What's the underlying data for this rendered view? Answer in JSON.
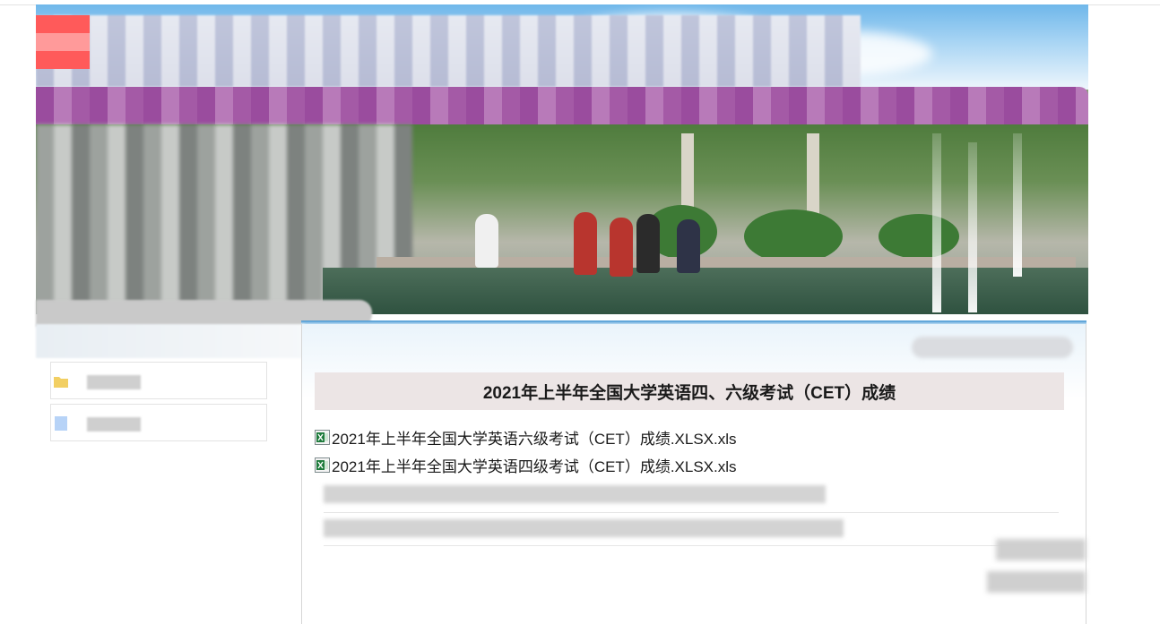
{
  "page": {
    "article_title": "2021年上半年全国大学英语四、六级考试（CET）成绩"
  },
  "attachments": [
    {
      "label": "2021年上半年全国大学英语六级考试（CET）成绩.XLSX.xls",
      "icon": "excel-file-icon"
    },
    {
      "label": "2021年上半年全国大学英语四级考试（CET）成绩.XLSX.xls",
      "icon": "excel-file-icon"
    }
  ],
  "sidebar": {
    "items": [
      {
        "icon": "folder-icon",
        "icon_color": "#f2cf63"
      },
      {
        "icon": "page-icon",
        "icon_color": "#b7d3f7"
      }
    ]
  },
  "colors": {
    "banner_purple": "#9a4c9e",
    "accent_blue": "#3f92d0",
    "title_bar": "#ece5e5"
  }
}
